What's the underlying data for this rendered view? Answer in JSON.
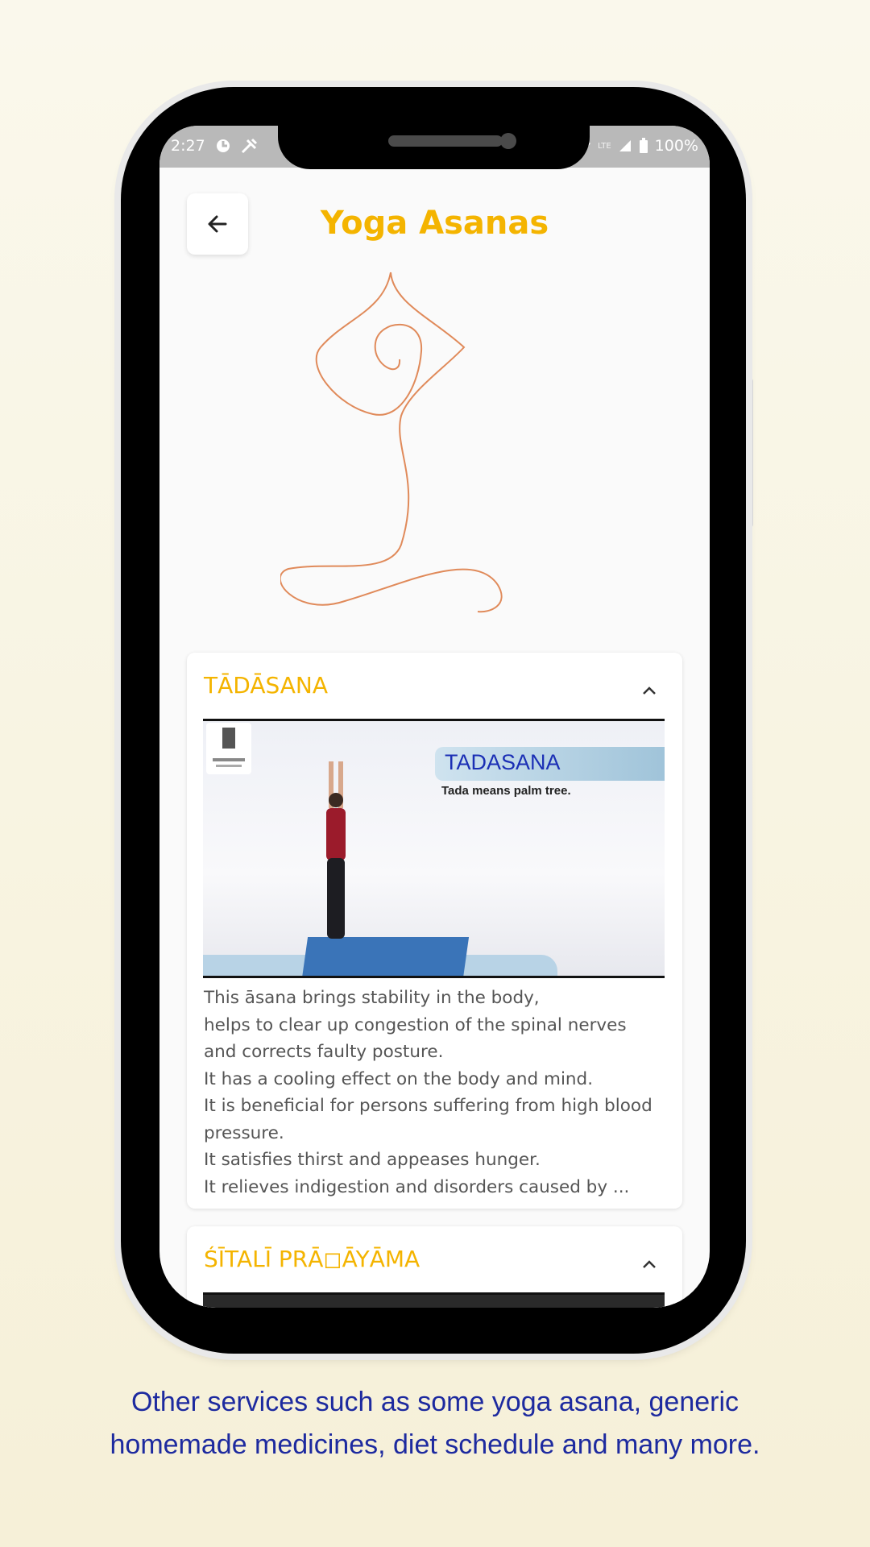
{
  "status_bar": {
    "time": "2:27",
    "battery": "100%",
    "network": "LTE"
  },
  "header": {
    "title": "Yoga Asanas",
    "back_icon": "arrow-left-icon"
  },
  "hero": {
    "illustration": "yoga-pose-line-art",
    "stroke_color": "#e08a5a"
  },
  "cards": [
    {
      "title": "TĀDĀSANA",
      "expanded": true,
      "video": {
        "banner_title": "TADASANA",
        "banner_subtitle": "Tada means palm tree.",
        "logo": "ministry-of-ayush-logo"
      },
      "description": [
        "This āsana brings stability in the body,",
        "helps to clear up congestion of the spinal nerves",
        "and corrects faulty posture.",
        "It has a cooling effect on the body and mind.",
        "It is beneficial for persons suffering from high blood",
        "pressure.",
        "It satisfies thirst and appeases hunger.",
        "It relieves indigestion and disorders caused by ..."
      ]
    },
    {
      "title": "ŚĪTALĪ PRĀ◻ĀYĀMA",
      "expanded": true
    }
  ],
  "caption": {
    "line1": "Other services such as some yoga asana, generic",
    "line2": "homemade medicines, diet schedule and many more."
  },
  "colors": {
    "accent": "#f4b400",
    "caption": "#1d2a9f",
    "background": "#f6f0d8"
  }
}
